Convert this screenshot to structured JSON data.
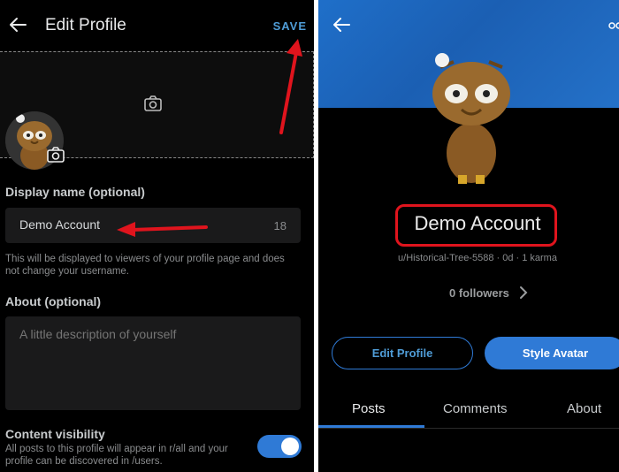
{
  "edit_profile": {
    "title": "Edit Profile",
    "save_label": "SAVE",
    "display_name_label": "Display name (optional)",
    "display_name_value": "Demo Account",
    "display_name_remaining": "18",
    "display_name_helper": "This will be displayed to viewers of your profile page and does not change your username.",
    "about_label": "About (optional)",
    "about_placeholder": "A little description of yourself",
    "content_visibility_label": "Content visibility",
    "content_visibility_helper": "All posts to this profile will appear in r/all and your profile can be discovered in /users.",
    "content_visibility_on": true
  },
  "profile": {
    "display_name": "Demo Account",
    "meta": "u/Historical-Tree-5588 · 0d · 1 karma",
    "followers": "0 followers",
    "edit_button": "Edit Profile",
    "style_avatar_button": "Style Avatar",
    "tabs": [
      {
        "label": "Posts",
        "active": true
      },
      {
        "label": "Comments",
        "active": false
      },
      {
        "label": "About",
        "active": false
      }
    ]
  },
  "colors": {
    "accent": "#2f7ad6",
    "annotation_red": "#e0141d",
    "background": "#000000"
  },
  "icons": [
    "back-arrow-icon",
    "camera-icon",
    "share-icon",
    "chevron-right-icon"
  ]
}
